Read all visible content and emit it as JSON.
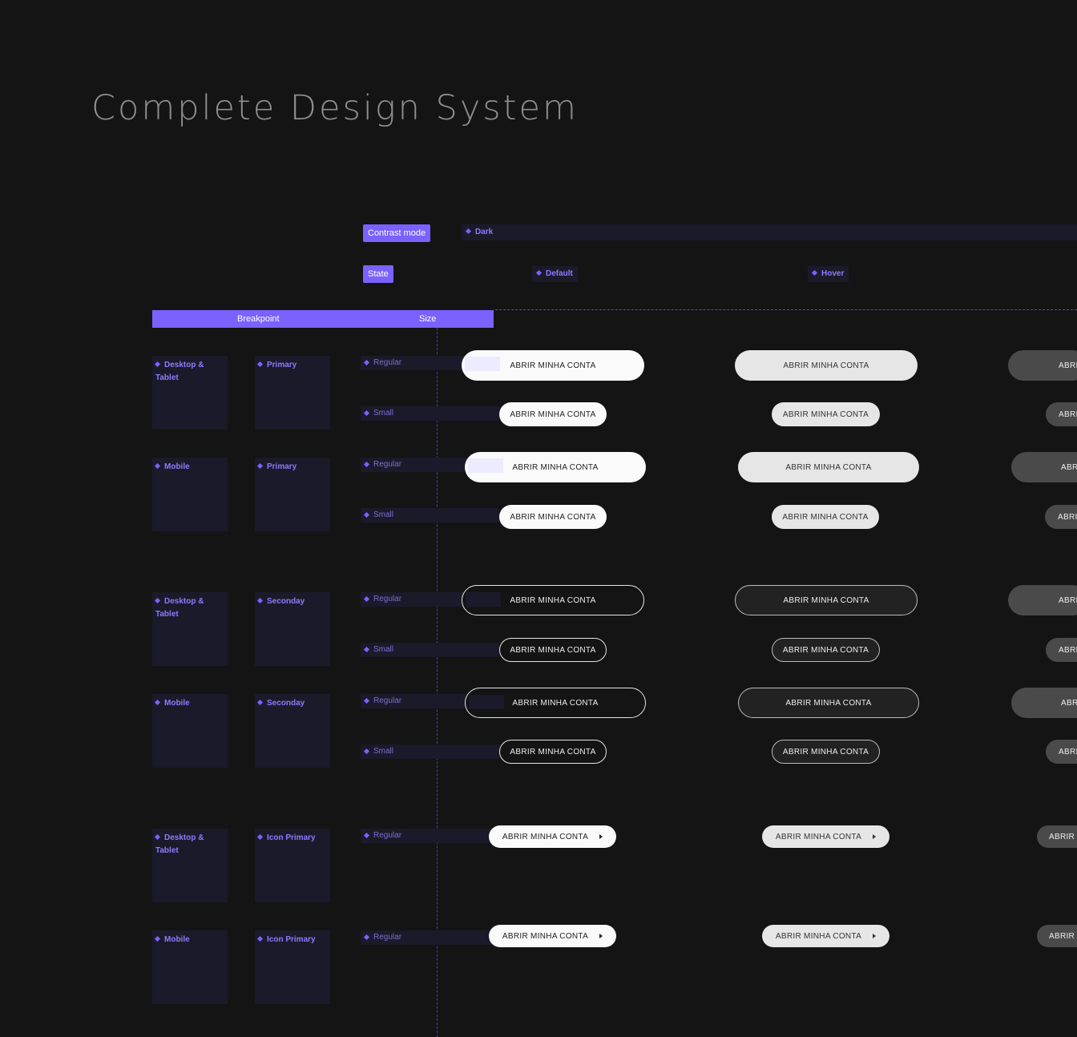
{
  "title": "Complete Design System",
  "controls": {
    "contrast_mode_label": "Contrast mode",
    "contrast_value": "Dark",
    "state_label": "State",
    "states": [
      "Default",
      "Hover"
    ]
  },
  "header": {
    "breakpoint": "Breakpoint",
    "size": "Size"
  },
  "groups": [
    {
      "breakpoint": "Desktop &\nTablet",
      "variant": "Primary"
    },
    {
      "breakpoint": "Mobile",
      "variant": "Primary"
    },
    {
      "breakpoint": "Desktop &\nTablet",
      "variant": "Seconday"
    },
    {
      "breakpoint": "Mobile",
      "variant": "Seconday"
    },
    {
      "breakpoint": "Desktop &\nTablet",
      "variant": "Icon Primary"
    },
    {
      "breakpoint": "Mobile",
      "variant": "Icon Primary"
    }
  ],
  "sizes": {
    "regular": "Regular",
    "small": "Small"
  },
  "button_label": "ABRIR MINHA CONTA",
  "clipped": {
    "abri": "ABRI",
    "abr": "ABR",
    "abrir_m": "ABRIR M"
  },
  "colors": {
    "accent": "#7b61ff",
    "background": "#141414",
    "card": "#1b1a2a"
  }
}
